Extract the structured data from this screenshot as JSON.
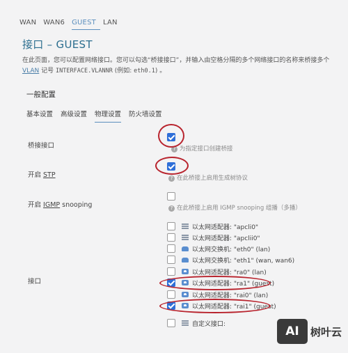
{
  "top_tabs": [
    {
      "label": "WAN",
      "active": false
    },
    {
      "label": "WAN6",
      "active": false
    },
    {
      "label": "GUEST",
      "active": true
    },
    {
      "label": "LAN",
      "active": false
    }
  ],
  "page_title": "接口 – GUEST",
  "description": {
    "line1": "在此页面，您可以配置网络接口。您可以勾选“桥接接口”，并输入由空格分隔的多个网络接口的名称来桥接多个",
    "vlan_link": "VLAN",
    "line2_a": " 记号 ",
    "line2_code": "INTERFACE.VLANNR",
    "line2_b": " (例如: ",
    "line2_example": "eth0.1",
    "line2_c": ") 。"
  },
  "section_title": "一般配置",
  "sub_tabs": [
    {
      "label": "基本设置",
      "active": false
    },
    {
      "label": "高级设置",
      "active": false
    },
    {
      "label": "物理设置",
      "active": true
    },
    {
      "label": "防火墙设置",
      "active": false
    }
  ],
  "bridge": {
    "label": "桥接接口",
    "checked": true,
    "hint": "为指定接口创建桥接"
  },
  "stp": {
    "label_prefix": "开启 ",
    "label_u": "STP",
    "checked": true,
    "hint": "在此桥接上启用生成树协议"
  },
  "igmp": {
    "label_prefix": "开启 ",
    "label_u": "IGMP",
    "label_suffix": " snooping",
    "checked": false,
    "hint": "在此桥接上启用 IGMP snooping 组播（多播）"
  },
  "interface_label": "接口",
  "interfaces": [
    {
      "icon": "ethernet-icon",
      "text": "以太网适配器: \"apcli0\"",
      "checked": false
    },
    {
      "icon": "ethernet-icon",
      "text": "以太网适配器: \"apclii0\"",
      "checked": false
    },
    {
      "icon": "switch-icon",
      "text": "以太网交换机: \"eth0\" (lan)",
      "checked": false
    },
    {
      "icon": "switch-icon",
      "text": "以太网交换机: \"eth1\" (wan, wan6)",
      "checked": false
    },
    {
      "icon": "wireless-icon",
      "text": "以太网适配器: \"ra0\" (lan)",
      "checked": false
    },
    {
      "icon": "wireless-icon",
      "text": "以太网适配器: \"ra1\" (guest)",
      "checked": true
    },
    {
      "icon": "wireless-icon",
      "text": "以太网适配器: \"rai0\" (lan)",
      "checked": false
    },
    {
      "icon": "wireless-icon",
      "text": "以太网适配器: \"rai1\" (guest)",
      "checked": true
    },
    {
      "icon": "ethernet-icon",
      "text": "自定义接口:",
      "checked": false
    }
  ],
  "watermark": {
    "logo": "AI",
    "text": "树叶云"
  },
  "colors": {
    "accent": "#5a8ebd",
    "title": "#2c6e8f",
    "checkbox": "#2e6fd8",
    "annotation": "#b8232d"
  }
}
